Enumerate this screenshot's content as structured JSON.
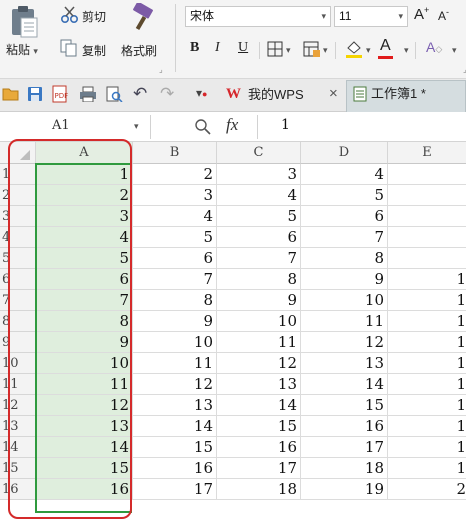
{
  "ribbon": {
    "paste": "粘贴",
    "cut": "剪切",
    "copy": "复制",
    "format_painter": "格式刷",
    "font_name": "宋体",
    "font_size": "11",
    "bold": "B",
    "italic": "I",
    "underline": "U"
  },
  "tabs": {
    "wps": "我的WPS",
    "close": "×",
    "workbook": "工作簿1 *"
  },
  "formula_bar": {
    "cell_ref": "A1",
    "fx": "fx",
    "value": "1"
  },
  "sheet": {
    "columns": [
      "A",
      "B",
      "C",
      "D",
      "E"
    ],
    "rows": [
      {
        "n": "1",
        "a": "1",
        "b": "2",
        "c": "3",
        "d": "4",
        "e": ""
      },
      {
        "n": "2",
        "a": "2",
        "b": "3",
        "c": "4",
        "d": "5",
        "e": ""
      },
      {
        "n": "3",
        "a": "3",
        "b": "4",
        "c": "5",
        "d": "6",
        "e": ""
      },
      {
        "n": "4",
        "a": "4",
        "b": "5",
        "c": "6",
        "d": "7",
        "e": ""
      },
      {
        "n": "5",
        "a": "5",
        "b": "6",
        "c": "7",
        "d": "8",
        "e": ""
      },
      {
        "n": "6",
        "a": "6",
        "b": "7",
        "c": "8",
        "d": "9",
        "e": "1"
      },
      {
        "n": "7",
        "a": "7",
        "b": "8",
        "c": "9",
        "d": "10",
        "e": "1"
      },
      {
        "n": "8",
        "a": "8",
        "b": "9",
        "c": "10",
        "d": "11",
        "e": "1"
      },
      {
        "n": "9",
        "a": "9",
        "b": "10",
        "c": "11",
        "d": "12",
        "e": "1"
      },
      {
        "n": "10",
        "a": "10",
        "b": "11",
        "c": "12",
        "d": "13",
        "e": "1"
      },
      {
        "n": "11",
        "a": "11",
        "b": "12",
        "c": "13",
        "d": "14",
        "e": "1"
      },
      {
        "n": "12",
        "a": "12",
        "b": "13",
        "c": "14",
        "d": "15",
        "e": "1"
      },
      {
        "n": "13",
        "a": "13",
        "b": "14",
        "c": "15",
        "d": "16",
        "e": "1"
      },
      {
        "n": "14",
        "a": "14",
        "b": "15",
        "c": "16",
        "d": "17",
        "e": "1"
      },
      {
        "n": "15",
        "a": "15",
        "b": "16",
        "c": "17",
        "d": "18",
        "e": "1"
      },
      {
        "n": "16",
        "a": "16",
        "b": "17",
        "c": "18",
        "d": "19",
        "e": "2"
      }
    ]
  },
  "colors": {
    "selection_green": "#2f9a3e",
    "annotation_red": "#d42a2a",
    "wps_red": "#d6262b"
  }
}
